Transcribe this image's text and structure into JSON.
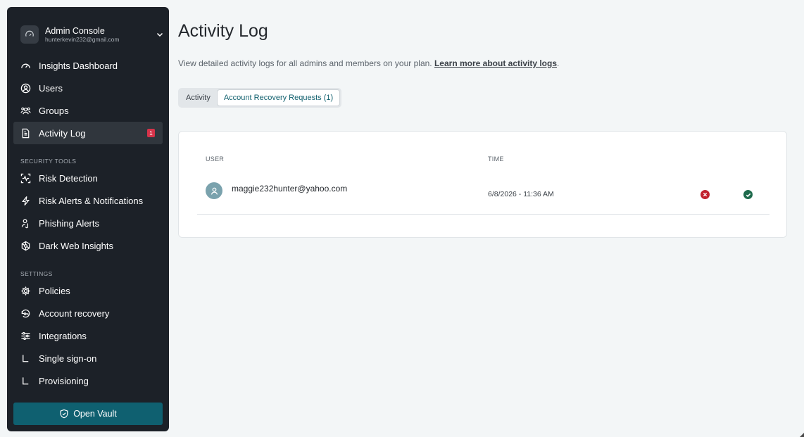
{
  "account": {
    "title": "Admin Console",
    "email": "hunterkevin232@gmail.com"
  },
  "nav": {
    "insights": "Insights Dashboard",
    "users": "Users",
    "groups": "Groups",
    "activity_log": "Activity Log",
    "activity_badge": "1",
    "security_tools_label": "SECURITY TOOLS",
    "risk_detection": "Risk Detection",
    "risk_alerts": "Risk Alerts & Notifications",
    "phishing": "Phishing Alerts",
    "dark_web": "Dark Web Insights",
    "settings_label": "SETTINGS",
    "policies": "Policies",
    "account_recovery": "Account recovery",
    "integrations": "Integrations",
    "sso": "Single sign-on",
    "provisioning": "Provisioning",
    "open_vault": "Open Vault"
  },
  "main": {
    "title": "Activity Log",
    "description": "View detailed activity logs for all admins and members on your plan. ",
    "learn_more": "Learn more about activity logs",
    "period": ".",
    "tabs": [
      "Activity",
      "Account Recovery Requests (1)"
    ],
    "table": {
      "headers": [
        "USER",
        "TIME"
      ],
      "rows": [
        {
          "user": "maggie232hunter@yahoo.com",
          "time": "6/8/2026 - 11:36 AM"
        }
      ]
    }
  },
  "colors": {
    "sidebar_bg": "#1c2128",
    "accent": "#0f6070",
    "badge": "#d6334a",
    "deny": "#c1232f",
    "approve": "#1e6a4c"
  }
}
